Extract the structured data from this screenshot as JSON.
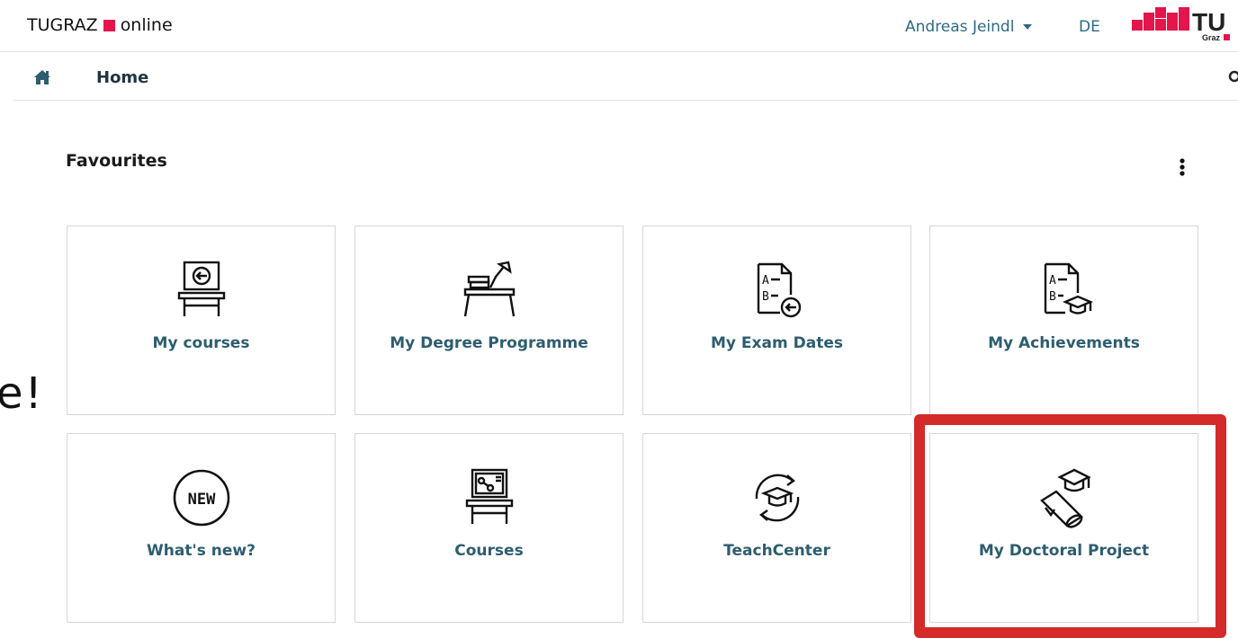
{
  "header": {
    "brand_left": "TUGRAZ",
    "brand_right": "online",
    "user_name": "Andreas Jeindl",
    "language": "DE",
    "logo_text": "TU",
    "logo_subtext": "Graz"
  },
  "nav": {
    "home_label": "Home"
  },
  "favourites": {
    "title": "Favourites",
    "tiles": [
      {
        "label": "My courses",
        "icon": "classroom-icon"
      },
      {
        "label": "My Degree Programme",
        "icon": "desk-lamp-icon"
      },
      {
        "label": "My Exam Dates",
        "icon": "exam-document-icon"
      },
      {
        "label": "My Achievements",
        "icon": "achievement-document-icon"
      },
      {
        "label": "What's new?",
        "icon": "new-badge-icon"
      },
      {
        "label": "Courses",
        "icon": "presentation-board-icon"
      },
      {
        "label": "TeachCenter",
        "icon": "graduation-cycle-icon"
      },
      {
        "label": "My Doctoral Project",
        "icon": "diploma-cap-icon"
      }
    ],
    "new_badge_text": "NEW"
  },
  "overlay": {
    "side_text": "e!"
  },
  "colors": {
    "accent": "#2d6a86",
    "tile_label": "#2d5d70",
    "brand_red": "#e4154b",
    "highlight_red": "#d42a2a"
  }
}
